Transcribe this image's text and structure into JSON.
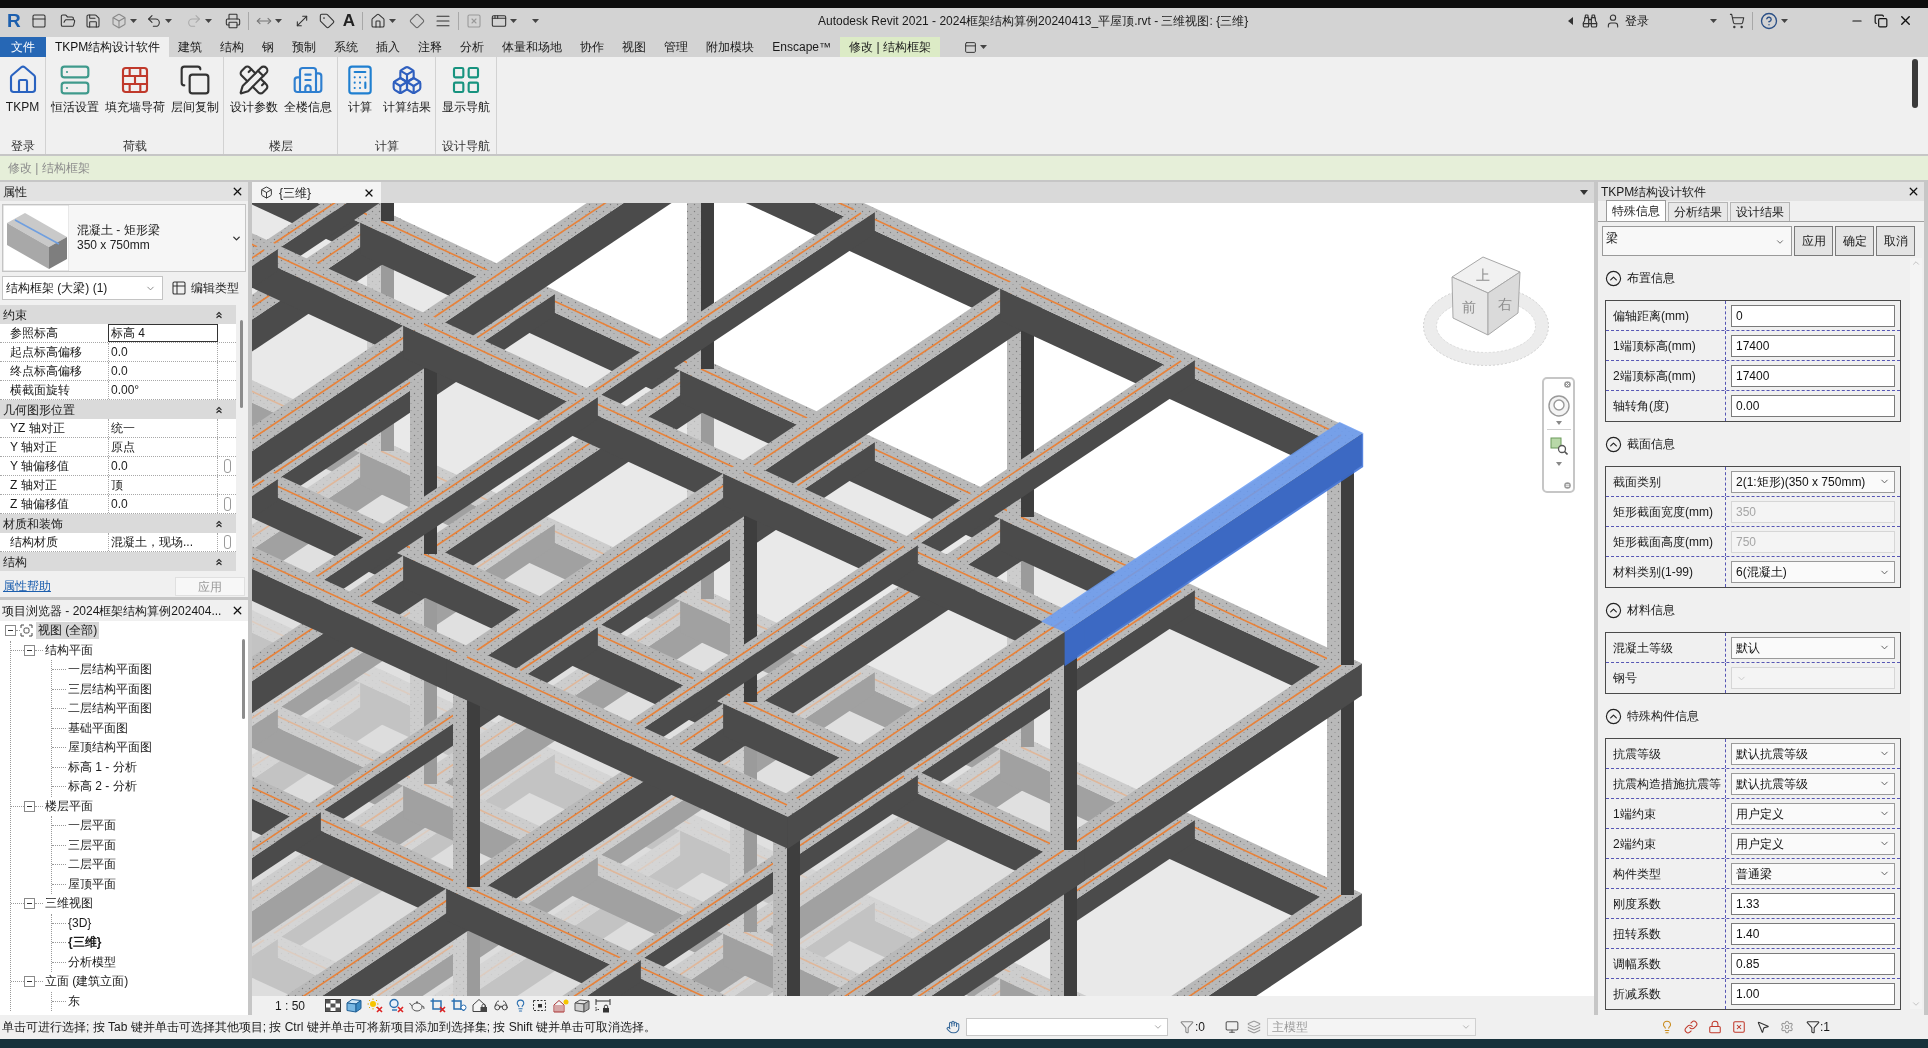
{
  "title_bar": {
    "logo": "R",
    "text_tool": "A",
    "title": "Autodesk Revit 2021 - 2024框架结构算例20240413_平屋顶.rvt - 三维视图: {三维}",
    "sign_in": "登录"
  },
  "ribbon_tabs": [
    {
      "label": "文件",
      "kind": "application",
      "selected": false
    },
    {
      "label": "TKPM结构设计软件",
      "kind": "tab",
      "selected": true
    },
    {
      "label": "建筑",
      "kind": "tab",
      "selected": false
    },
    {
      "label": "结构",
      "kind": "tab",
      "selected": false
    },
    {
      "label": "钢",
      "kind": "tab",
      "selected": false
    },
    {
      "label": "预制",
      "kind": "tab",
      "selected": false
    },
    {
      "label": "系统",
      "kind": "tab",
      "selected": false
    },
    {
      "label": "插入",
      "kind": "tab",
      "selected": false
    },
    {
      "label": "注释",
      "kind": "tab",
      "selected": false
    },
    {
      "label": "分析",
      "kind": "tab",
      "selected": false
    },
    {
      "label": "体量和场地",
      "kind": "tab",
      "selected": false
    },
    {
      "label": "协作",
      "kind": "tab",
      "selected": false
    },
    {
      "label": "视图",
      "kind": "tab",
      "selected": false
    },
    {
      "label": "管理",
      "kind": "tab",
      "selected": false
    },
    {
      "label": "附加模块",
      "kind": "tab",
      "selected": false
    },
    {
      "label": "Enscape™",
      "kind": "tab",
      "selected": false
    },
    {
      "label": "修改 | 结构框架",
      "kind": "contextual",
      "selected": false
    }
  ],
  "ribbon_panels": [
    {
      "label": "登录",
      "buttons": [
        "TKPM"
      ]
    },
    {
      "label": "荷载",
      "buttons": [
        "恒活设置",
        "填充墙导荷",
        "层间复制"
      ]
    },
    {
      "label": "楼层",
      "buttons": [
        "设计参数",
        "全楼信息"
      ]
    },
    {
      "label": "计算",
      "buttons": [
        "计算",
        "计算结果"
      ]
    },
    {
      "label": "设计导航",
      "buttons": [
        "显示导航"
      ]
    }
  ],
  "options_bar": {
    "text": "修改 | 结构框架"
  },
  "properties": {
    "title": "属性",
    "type": {
      "name": "混凝土 - 矩形梁",
      "size": "350 x 750mm"
    },
    "filter": "结构框架 (大梁) (1)",
    "edit_type": "编辑类型",
    "groups": [
      {
        "label": "约束",
        "expanded": true,
        "rows": [
          {
            "name": "参照标高",
            "value": "标高 4",
            "editing": true,
            "associate_button": false
          },
          {
            "name": "起点标高偏移",
            "value": "0.0",
            "editing": false,
            "associate_button": false
          },
          {
            "name": "终点标高偏移",
            "value": "0.0",
            "editing": false,
            "associate_button": false
          },
          {
            "name": "横截面旋转",
            "value": "0.00°",
            "editing": false,
            "associate_button": false
          }
        ]
      },
      {
        "label": "几何图形位置",
        "expanded": true,
        "rows": [
          {
            "name": "YZ 轴对正",
            "value": "统一",
            "editing": false,
            "associate_button": false
          },
          {
            "name": "Y 轴对正",
            "value": "原点",
            "editing": false,
            "associate_button": false
          },
          {
            "name": "Y 轴偏移值",
            "value": "0.0",
            "editing": false,
            "associate_button": true
          },
          {
            "name": "Z 轴对正",
            "value": "顶",
            "editing": false,
            "associate_button": false
          },
          {
            "name": "Z 轴偏移值",
            "value": "0.0",
            "editing": false,
            "associate_button": true
          }
        ]
      },
      {
        "label": "材质和装饰",
        "expanded": true,
        "rows": [
          {
            "name": "结构材质",
            "value": "混凝土，现场...",
            "editing": false,
            "associate_button": true
          }
        ]
      },
      {
        "label": "结构",
        "expanded": true
      }
    ],
    "help_link": "属性帮助",
    "apply": {
      "label": "应用",
      "disabled": true
    }
  },
  "project_browser": {
    "title": "项目浏览器 - 2024框架结构算例202404...",
    "tree": [
      {
        "label": "视图 (全部)",
        "selected": true,
        "expanded": true,
        "children": [
          {
            "label": "结构平面",
            "selected": false,
            "expanded": true,
            "children": [
              {
                "label": "一层结构平面图",
                "selected": false,
                "current": false
              },
              {
                "label": "三层结构平面图",
                "selected": false,
                "current": false
              },
              {
                "label": "二层结构平面图",
                "selected": false,
                "current": false
              },
              {
                "label": "基础平面图",
                "selected": false,
                "current": false
              },
              {
                "label": "屋顶结构平面图",
                "selected": false,
                "current": false
              },
              {
                "label": "标高 1 - 分析",
                "selected": false,
                "current": false
              },
              {
                "label": "标高 2 - 分析",
                "selected": false,
                "current": false
              }
            ]
          },
          {
            "label": "楼层平面",
            "selected": false,
            "expanded": true,
            "children": [
              {
                "label": "一层平面",
                "selected": false,
                "current": false
              },
              {
                "label": "三层平面",
                "selected": false,
                "current": false
              },
              {
                "label": "二层平面",
                "selected": false,
                "current": false
              },
              {
                "label": "屋顶平面",
                "selected": false,
                "current": false
              }
            ]
          },
          {
            "label": "三维视图",
            "selected": false,
            "expanded": true,
            "children": [
              {
                "label": "{3D}",
                "selected": false,
                "current": false
              },
              {
                "label": "{三维}",
                "selected": false,
                "current": true
              },
              {
                "label": "分析模型",
                "selected": false,
                "current": false
              }
            ]
          },
          {
            "label": "立面 (建筑立面)",
            "selected": false,
            "expanded": true,
            "children": [
              {
                "label": "东",
                "selected": false,
                "current": false
              }
            ]
          }
        ]
      }
    ]
  },
  "view": {
    "tab": "{三维}",
    "view_cube_faces": [
      "上",
      "前",
      "右"
    ],
    "scale": "1 : 50"
  },
  "tkpm_panel": {
    "title": "TKPM结构设计软件",
    "tabs": [
      {
        "label": "特殊信息",
        "selected": true
      },
      {
        "label": "分析结果",
        "selected": false
      },
      {
        "label": "设计结果",
        "selected": false
      }
    ],
    "member_type": "梁",
    "buttons": [
      "应用",
      "确定",
      "取消"
    ],
    "sections": [
      {
        "title": "布置信息",
        "expanded": true,
        "fields": [
          {
            "label": "偏轴距离(mm)",
            "value": "0",
            "kind": "text",
            "disabled": false
          },
          {
            "label": "1端顶标高(mm)",
            "value": "17400",
            "kind": "text",
            "disabled": false
          },
          {
            "label": "2端顶标高(mm)",
            "value": "17400",
            "kind": "text",
            "disabled": false
          },
          {
            "label": "轴转角(度)",
            "value": "0.00",
            "kind": "text",
            "disabled": false
          }
        ]
      },
      {
        "title": "截面信息",
        "expanded": true,
        "fields": [
          {
            "label": "截面类别",
            "value": "2(1:矩形)(350 x 750mm)",
            "kind": "select",
            "disabled": false
          },
          {
            "label": "矩形截面宽度(mm)",
            "value": "350",
            "kind": "text",
            "disabled": true
          },
          {
            "label": "矩形截面高度(mm)",
            "value": "750",
            "kind": "text",
            "disabled": true
          },
          {
            "label": "材料类别(1-99)",
            "value": "6(混凝土)",
            "kind": "select",
            "disabled": false
          }
        ]
      },
      {
        "title": "材料信息",
        "expanded": true,
        "fields": [
          {
            "label": "混凝土等级",
            "value": "默认",
            "kind": "select",
            "disabled": false
          },
          {
            "label": "钢号",
            "kind": "select",
            "disabled": true
          }
        ]
      },
      {
        "title": "特殊构件信息",
        "expanded": true,
        "fields": [
          {
            "label": "抗震等级",
            "value": "默认抗震等级",
            "kind": "select",
            "disabled": false
          },
          {
            "label": "抗震构造措施抗震等",
            "value": "默认抗震等级",
            "kind": "select",
            "disabled": false
          },
          {
            "label": "1端约束",
            "value": "用户定义",
            "kind": "select",
            "disabled": false
          },
          {
            "label": "2端约束",
            "value": "用户定义",
            "kind": "select",
            "disabled": false
          },
          {
            "label": "构件类型",
            "value": "普通梁",
            "kind": "select",
            "disabled": false
          },
          {
            "label": "刚度系数",
            "value": "1.33",
            "kind": "text",
            "disabled": false
          },
          {
            "label": "扭转系数",
            "value": "1.40",
            "kind": "text",
            "disabled": false
          },
          {
            "label": "调幅系数",
            "value": "0.85",
            "kind": "text",
            "disabled": false
          },
          {
            "label": "折减系数",
            "value": "1.00",
            "kind": "text",
            "disabled": false
          }
        ]
      }
    ]
  },
  "status_bar": {
    "hint": "单击可进行选择; 按 Tab 键并单击可选择其他项目; 按 Ctrl 键并单击可将新项目添加到选择集; 按 Shift 键并单击可取消选择。",
    "count": ":0",
    "model": {
      "value": "主模型",
      "disabled": true
    },
    "selection_count": ":1"
  }
}
